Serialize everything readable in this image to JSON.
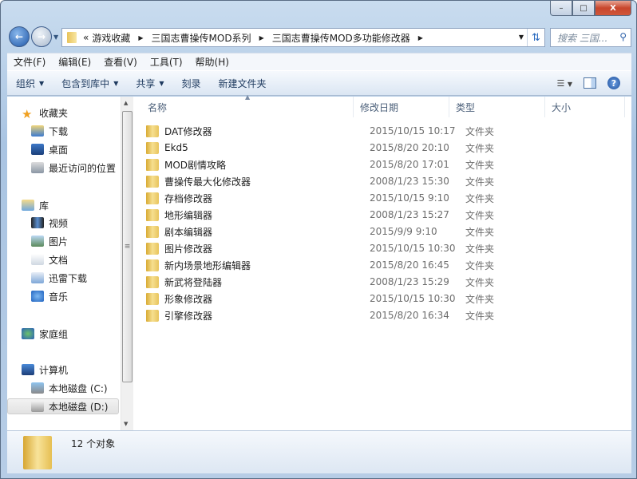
{
  "window": {
    "minimize": "–",
    "maximize": "□",
    "close": "X"
  },
  "address": {
    "overflow": "«",
    "crumbs": [
      "游戏收藏",
      "三国志曹操传MOD系列",
      "三国志曹操传MOD多功能修改器"
    ],
    "search_placeholder": "搜索 三国..."
  },
  "menu": [
    "文件(F)",
    "编辑(E)",
    "查看(V)",
    "工具(T)",
    "帮助(H)"
  ],
  "commands": [
    {
      "label": "组织",
      "dropdown": true
    },
    {
      "label": "包含到库中",
      "dropdown": true
    },
    {
      "label": "共享",
      "dropdown": true
    },
    {
      "label": "刻录",
      "dropdown": false
    },
    {
      "label": "新建文件夹",
      "dropdown": false
    }
  ],
  "nav": [
    {
      "label": "收藏夹",
      "icon": "star-icon",
      "level": 0
    },
    {
      "label": "下载",
      "icon": "downloads-icon",
      "level": 1
    },
    {
      "label": "桌面",
      "icon": "desktop-icon",
      "level": 1
    },
    {
      "label": "最近访问的位置",
      "icon": "recent-places-icon",
      "level": 1
    },
    {
      "label": "库",
      "icon": "library-icon",
      "level": 0
    },
    {
      "label": "视频",
      "icon": "video-icon",
      "level": 1
    },
    {
      "label": "图片",
      "icon": "pictures-icon",
      "level": 1
    },
    {
      "label": "文档",
      "icon": "documents-icon",
      "level": 1
    },
    {
      "label": "迅雷下载",
      "icon": "thunder-download-icon",
      "level": 1
    },
    {
      "label": "音乐",
      "icon": "music-icon",
      "level": 1
    },
    {
      "label": "家庭组",
      "icon": "homegroup-icon",
      "level": 0
    },
    {
      "label": "计算机",
      "icon": "computer-icon",
      "level": 0
    },
    {
      "label": "本地磁盘 (C:)",
      "icon": "drive-c-icon",
      "level": 1
    },
    {
      "label": "本地磁盘 (D:)",
      "icon": "drive-d-icon",
      "level": 1,
      "selected": true
    }
  ],
  "columns": [
    "名称",
    "修改日期",
    "类型",
    "大小"
  ],
  "files": [
    {
      "name": "DAT修改器",
      "date": "2015/10/15 10:17",
      "type": "文件夹"
    },
    {
      "name": "Ekd5",
      "date": "2015/8/20 20:10",
      "type": "文件夹"
    },
    {
      "name": "MOD剧情攻略",
      "date": "2015/8/20 17:01",
      "type": "文件夹"
    },
    {
      "name": "曹操传最大化修改器",
      "date": "2008/1/23 15:30",
      "type": "文件夹"
    },
    {
      "name": "存档修改器",
      "date": "2015/10/15 9:10",
      "type": "文件夹"
    },
    {
      "name": "地形编辑器",
      "date": "2008/1/23 15:27",
      "type": "文件夹"
    },
    {
      "name": "剧本编辑器",
      "date": "2015/9/9 9:10",
      "type": "文件夹"
    },
    {
      "name": "图片修改器",
      "date": "2015/10/15 10:30",
      "type": "文件夹"
    },
    {
      "name": "新内场景地形编辑器",
      "date": "2015/8/20 16:45",
      "type": "文件夹"
    },
    {
      "name": "新武将登陆器",
      "date": "2008/1/23 15:29",
      "type": "文件夹"
    },
    {
      "name": "形象修改器",
      "date": "2015/10/15 10:30",
      "type": "文件夹"
    },
    {
      "name": "引擎修改器",
      "date": "2015/8/20 16:34",
      "type": "文件夹"
    }
  ],
  "status": {
    "count": "12 个对象"
  }
}
